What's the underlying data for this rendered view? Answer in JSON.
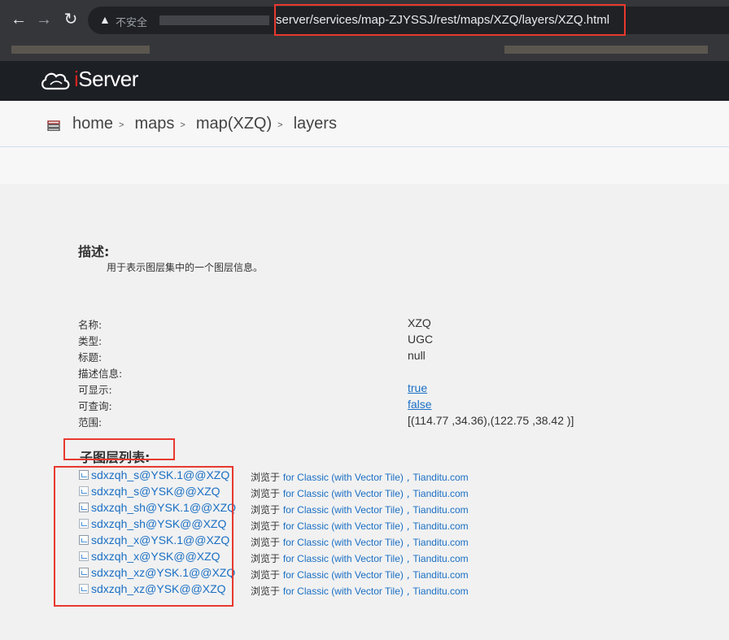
{
  "browser": {
    "insecure_label": "不安全",
    "url": "server/services/map-ZJYSSJ/rest/maps/XZQ/layers/XZQ.html"
  },
  "header": {
    "logo_prefix": "i",
    "logo_rest": "Server"
  },
  "breadcrumb": {
    "items": [
      {
        "label": "home",
        "sep": ">"
      },
      {
        "label": "maps",
        "sep": ">"
      },
      {
        "label": "map(XZQ)",
        "sep": ">"
      },
      {
        "label": "layers",
        "sep": ""
      }
    ]
  },
  "description": {
    "title": "描述:",
    "text": "用于表示图层集中的一个图层信息。"
  },
  "properties": [
    {
      "label": "名称:",
      "value": "XZQ"
    },
    {
      "label": "类型:",
      "value": "UGC"
    },
    {
      "label": "标题:",
      "value": "null"
    },
    {
      "label": "描述信息:",
      "value": ""
    },
    {
      "label": "可显示:",
      "value": "true"
    },
    {
      "label": "可查询:",
      "value": "false"
    },
    {
      "label": "范围:",
      "value": "[(114.77 ,34.36),(122.75 ,38.42 )]"
    }
  ],
  "sublayers": {
    "title": "子图层列表:",
    "browse_prefix": "浏览于",
    "browse_classic": "for Classic (with Vector Tile)",
    "browse_sep": ",",
    "browse_tianditu": "Tianditu.com",
    "items": [
      {
        "name": "sdxzqh_s@YSK.1@@XZQ"
      },
      {
        "name": "sdxzqh_s@YSK@@XZQ"
      },
      {
        "name": "sdxzqh_sh@YSK.1@@XZQ"
      },
      {
        "name": "sdxzqh_sh@YSK@@XZQ"
      },
      {
        "name": "sdxzqh_x@YSK.1@@XZQ"
      },
      {
        "name": "sdxzqh_x@YSK@@XZQ"
      },
      {
        "name": "sdxzqh_xz@YSK.1@@XZQ"
      },
      {
        "name": "sdxzqh_xz@YSK@@XZQ"
      }
    ]
  }
}
